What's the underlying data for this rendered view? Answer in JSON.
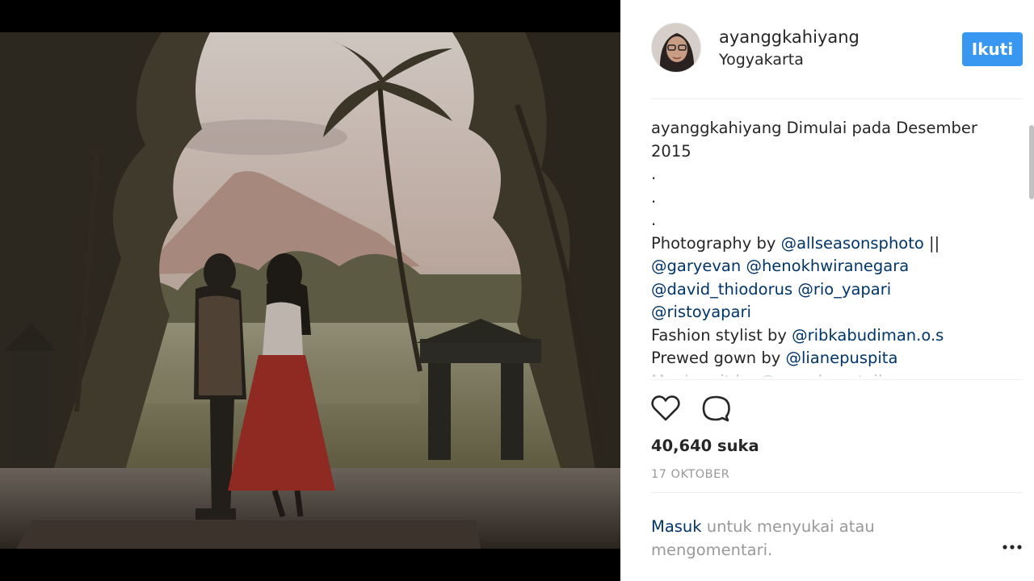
{
  "post": {
    "username": "ayanggkahiyang",
    "location": "Yogyakarta",
    "follow_label": "Ikuti",
    "caption_lines": [
      [
        {
          "text": "ayanggkahiyang",
          "mention": false
        },
        {
          "text": " Dimulai pada Desember",
          "mention": false
        }
      ],
      [
        {
          "text": "2015",
          "mention": false
        }
      ],
      [
        {
          "text": ".",
          "mention": false
        }
      ],
      [
        {
          "text": ".",
          "mention": false
        }
      ],
      [
        {
          "text": ".",
          "mention": false
        }
      ],
      [
        {
          "text": "Photography by ",
          "mention": false
        },
        {
          "text": "@allseasonsphoto",
          "mention": true
        },
        {
          "text": " ||",
          "mention": false
        }
      ],
      [
        {
          "text": "@garyevan",
          "mention": true
        },
        {
          "text": " ",
          "mention": false
        },
        {
          "text": "@henokhwiranegara",
          "mention": true
        }
      ],
      [
        {
          "text": "@david_thiodorus",
          "mention": true
        },
        {
          "text": " ",
          "mention": false
        },
        {
          "text": "@rio_yapari",
          "mention": true
        }
      ],
      [
        {
          "text": "@ristoyapari",
          "mention": true
        }
      ],
      [
        {
          "text": "Fashion stylist by ",
          "mention": false
        },
        {
          "text": "@ribkabudiman.o.s",
          "mention": true
        }
      ],
      [
        {
          "text": "Prewed gown by ",
          "mention": false
        },
        {
          "text": "@lianepuspita",
          "mention": true
        }
      ],
      [
        {
          "text": "Men's suit by ",
          "mention": false
        },
        {
          "text": "@wongbongtailor",
          "mention": true
        }
      ]
    ],
    "likes": "40,640 suka",
    "date": "17 OKTOBER",
    "login_link": "Masuk",
    "login_rest": " untuk menyukai atau mengomentari.",
    "icons": {
      "like": "heart-outline-icon",
      "comment": "speech-bubble-icon",
      "more": "ellipsis-icon"
    }
  },
  "colors": {
    "follow_button": "#3897f0",
    "mention": "#003569",
    "muted": "#999999",
    "text": "#262626"
  }
}
